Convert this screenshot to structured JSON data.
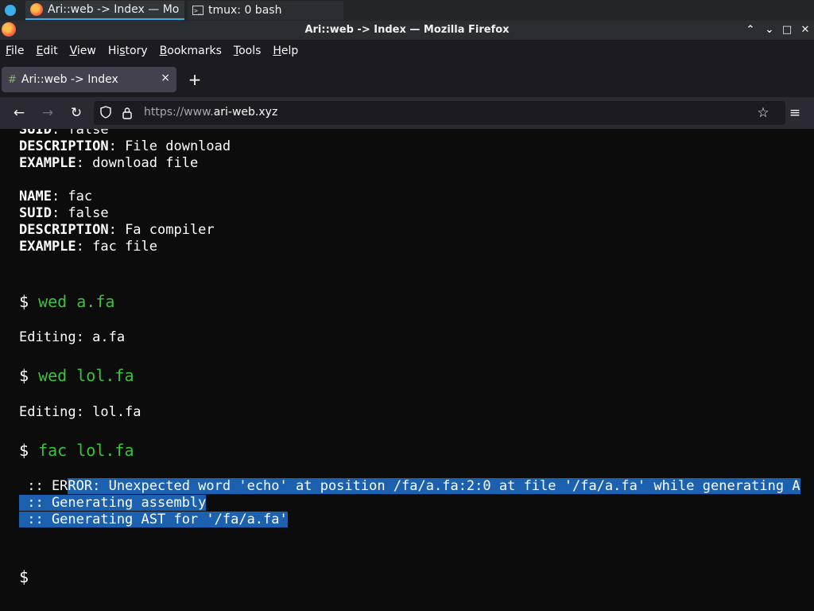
{
  "taskbar": {
    "tasks": [
      {
        "label": "Ari::web -> Index — Mo..."
      },
      {
        "label": "tmux: 0 bash"
      }
    ]
  },
  "window": {
    "title": "Ari::web -> Index — Mozilla Firefox",
    "buttons": {
      "minimize": "⌃",
      "restore": "⌄",
      "maximize": "□",
      "close": "✕"
    }
  },
  "menubar": {
    "items": [
      {
        "ul": "F",
        "rest": "ile"
      },
      {
        "ul": "E",
        "rest": "dit"
      },
      {
        "ul": "V",
        "rest": "iew"
      },
      {
        "pre": "Hi",
        "ul": "s",
        "rest": "tory"
      },
      {
        "ul": "B",
        "rest": "ookmarks"
      },
      {
        "ul": "T",
        "rest": "ools"
      },
      {
        "ul": "H",
        "rest": "elp"
      }
    ]
  },
  "tab": {
    "label": "Ari::web -> Index",
    "close": "×",
    "new_tab": "+"
  },
  "navbar": {
    "url_proto": "https://www.",
    "url_host": "ari-web.xyz",
    "back": "←",
    "forward": "→",
    "reload": "↻",
    "bookmark": "☆",
    "menu": "≡"
  },
  "terminal": {
    "cut_line": {
      "key": "SUID",
      "value": ": false"
    },
    "entry1": [
      {
        "key": "DESCRIPTION",
        "value": ": File download"
      },
      {
        "key": "EXAMPLE",
        "value": ": download file"
      }
    ],
    "entry2": [
      {
        "key": "NAME",
        "value": ": fac"
      },
      {
        "key": "SUID",
        "value": ": false"
      },
      {
        "key": "DESCRIPTION",
        "value": ": Fa compiler"
      },
      {
        "key": "EXAMPLE",
        "value": ": fac file"
      }
    ],
    "prompt_symbol": "$",
    "cmd1": "wed a.fa",
    "out1": "Editing: a.fa",
    "cmd2": "wed lol.fa",
    "out2": "Editing: lol.fa",
    "cmd3": "fac lol.fa",
    "err_prefix": " :: ER",
    "err_sel": "ROR: Unexpected word 'echo' at position /fa/a.fa:2:0 at file '/fa/a.fa' while generating A",
    "info1": " :: Generating assembly",
    "info2": " :: Generating AST for '/fa/a.fa'"
  }
}
